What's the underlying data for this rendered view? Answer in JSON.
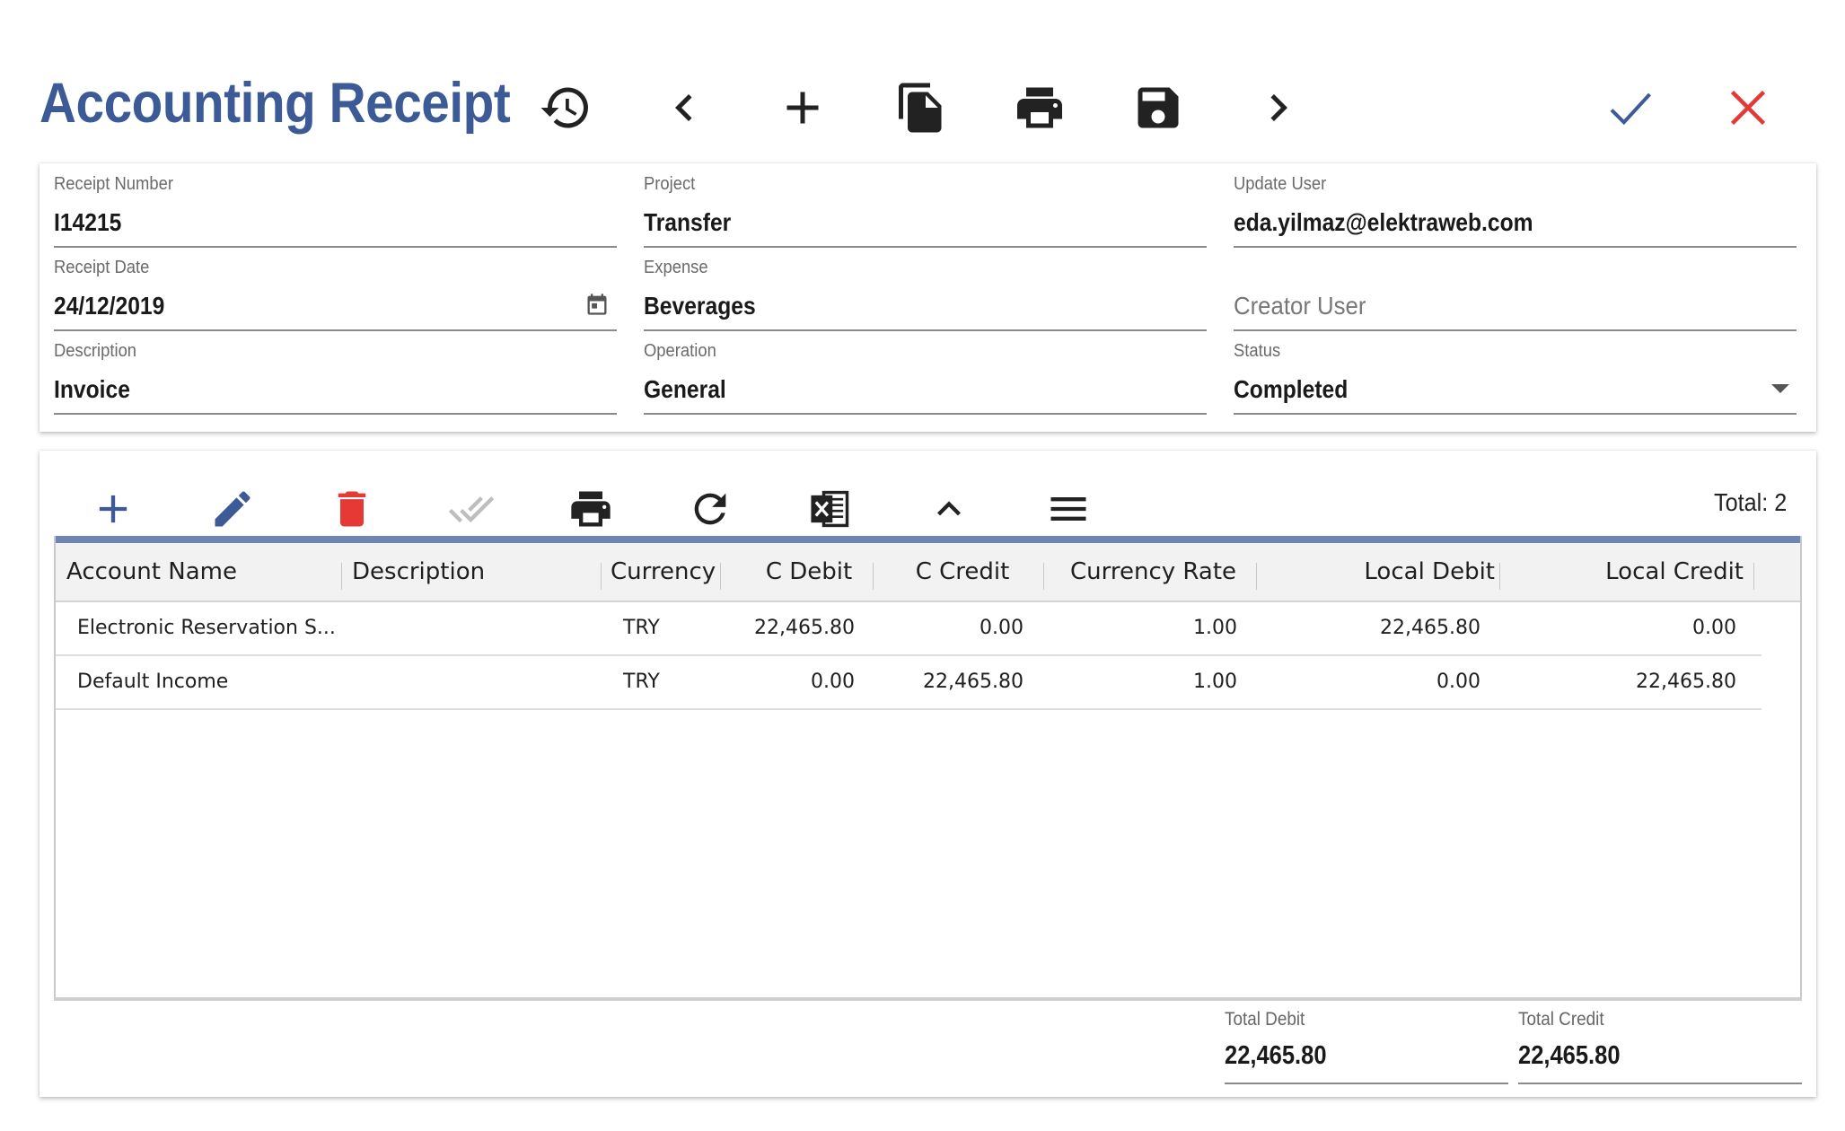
{
  "header": {
    "title": "Accounting Receipt",
    "buttons": [
      "history-icon",
      "chevron-left-icon",
      "plus-icon",
      "copy-icon",
      "print-icon",
      "save-icon",
      "chevron-right-icon",
      "check-icon",
      "close-icon"
    ]
  },
  "colors": {
    "accent": "#3c5a96",
    "confirm": "#3c5a96",
    "cancel": "#e53935",
    "delete": "#e53935",
    "table_topbar": "#6f86b5"
  },
  "form": {
    "receipt_number": {
      "label": "Receipt Number",
      "value": "I14215"
    },
    "project": {
      "label": "Project",
      "value": "Transfer"
    },
    "update_user": {
      "label": "Update User",
      "value": "eda.yilmaz@elektraweb.com"
    },
    "receipt_date": {
      "label": "Receipt Date",
      "value": "24/12/2019"
    },
    "expense": {
      "label": "Expense",
      "value": "Beverages"
    },
    "creator_user": {
      "placeholder": "Creator User"
    },
    "description": {
      "label": "Description",
      "value": "Invoice"
    },
    "operation": {
      "label": "Operation",
      "value": "General"
    },
    "status": {
      "label": "Status",
      "value": "Completed"
    }
  },
  "grid": {
    "toolbar": [
      "add-icon",
      "edit-icon",
      "delete-icon",
      "double-check-icon",
      "print-icon",
      "refresh-icon",
      "excel-icon",
      "chevron-up-icon",
      "menu-icon"
    ],
    "total_count": "Total: 2",
    "columns": [
      "Account Name",
      "Description",
      "Currency",
      "C Debit",
      "C Credit",
      "Currency Rate",
      "Local Debit",
      "Local Credit"
    ],
    "rows": [
      {
        "account_name": "Electronic Reservation S...",
        "description": "",
        "currency": "TRY",
        "c_debit": "22,465.80",
        "c_credit": "0.00",
        "currency_rate": "1.00",
        "local_debit": "22,465.80",
        "local_credit": "0.00"
      },
      {
        "account_name": "Default Income",
        "description": "",
        "currency": "TRY",
        "c_debit": "0.00",
        "c_credit": "22,465.80",
        "currency_rate": "1.00",
        "local_debit": "0.00",
        "local_credit": "22,465.80"
      }
    ]
  },
  "totals": {
    "total_debit": {
      "label": "Total Debit",
      "value": "22,465.80"
    },
    "total_credit": {
      "label": "Total Credit",
      "value": "22,465.80"
    }
  }
}
